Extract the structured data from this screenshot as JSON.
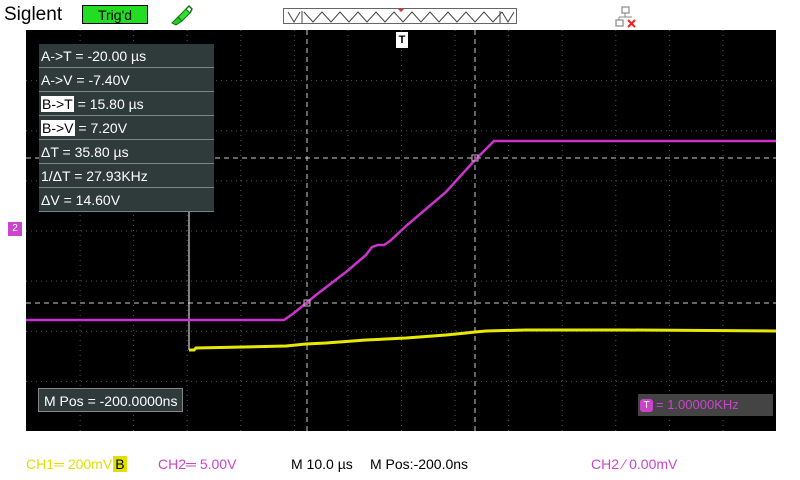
{
  "header": {
    "brand": "Siglent",
    "trigger_status": "Trig'd",
    "trigger_status_color": "#22dd22",
    "icons": [
      "probe-icon",
      "network-error-icon"
    ]
  },
  "measurements": [
    {
      "label": "A->T",
      "value": " = -20.00 µs"
    },
    {
      "label": "A->V",
      "value": " = -7.40V"
    },
    {
      "label": "B->T",
      "value": " = 15.80 µs"
    },
    {
      "label": "B->V",
      "value": " = 7.20V"
    },
    {
      "label": "ΔT",
      "value": " = 35.80 µs"
    },
    {
      "label": "1/ΔT",
      "value": " = 27.93KHz"
    },
    {
      "label": "ΔV",
      "value": " = 14.60V"
    }
  ],
  "display": {
    "mpos_box": "M Pos = -200.0000ns",
    "freq_readout": "= 1.00000KHz",
    "freq_tag": "T",
    "trigger_marker": "T",
    "ch2_marker": "2",
    "ch1_color": "#e8e800",
    "ch2_color": "#cc33cc"
  },
  "bottom": {
    "ch1": "CH1═ 200mV",
    "ch1_flag": "B",
    "ch2": "CH2═ 5.00V",
    "timebase": "M 10.0 µs",
    "mpos": "M Pos:-200.0ns",
    "trigger": "CH2 ∕ 0.00mV"
  }
}
